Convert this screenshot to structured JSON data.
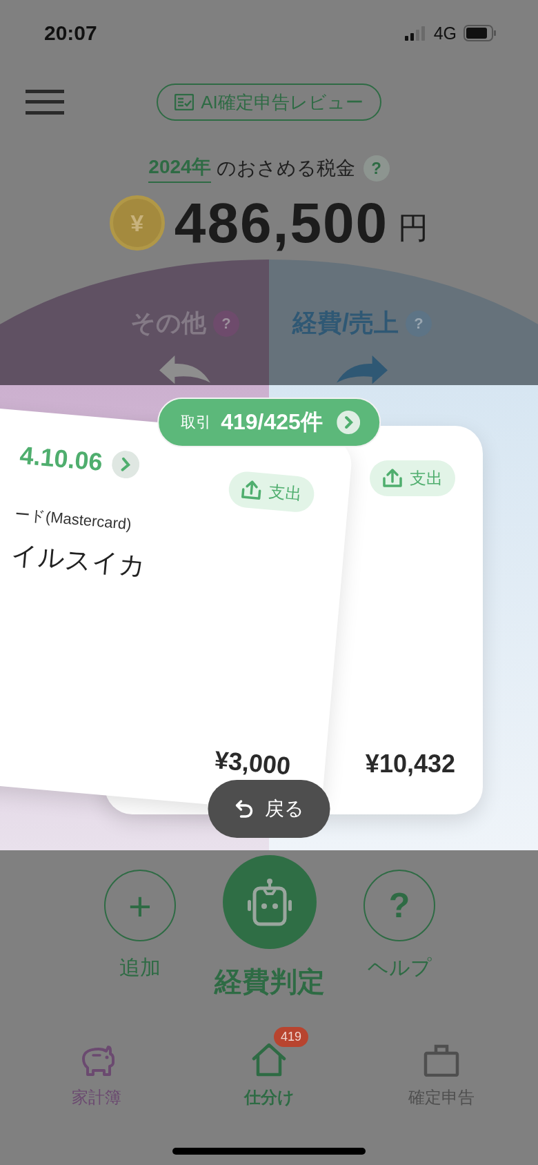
{
  "status_bar": {
    "time": "20:07",
    "network": "4G"
  },
  "header": {
    "review_button": "AI確定申告レビュー"
  },
  "tax": {
    "year": "2024年",
    "label": "のおさめる税金",
    "help": "?",
    "coin": "¥",
    "amount": "486,500",
    "unit": "円"
  },
  "swipe": {
    "left": {
      "label": "その他",
      "help": "?"
    },
    "right": {
      "label": "経費/売上",
      "help": "?"
    }
  },
  "counter": {
    "label": "取引",
    "count": "419/425件"
  },
  "cards": [
    {
      "date": "4.10.06",
      "account": "ード(Mastercard)",
      "description": "イルスイカ",
      "type": "支出",
      "amount": "¥3,000"
    },
    {
      "type": "支出",
      "amount": "¥10,432"
    }
  ],
  "undo_button": "戻る",
  "actions": [
    {
      "kind": "add",
      "glyph": "+",
      "label": "追加"
    },
    {
      "kind": "judge",
      "label": "経費判定"
    },
    {
      "kind": "help",
      "glyph": "?",
      "label": "ヘルプ"
    }
  ],
  "tabs": [
    {
      "label": "家計簿",
      "selected": false,
      "color": "#6b4a70"
    },
    {
      "label": "仕分け",
      "selected": true,
      "color": "#2e6b44",
      "badge": "419"
    },
    {
      "label": "確定申告",
      "selected": false,
      "color": "#4f4f4f"
    }
  ]
}
